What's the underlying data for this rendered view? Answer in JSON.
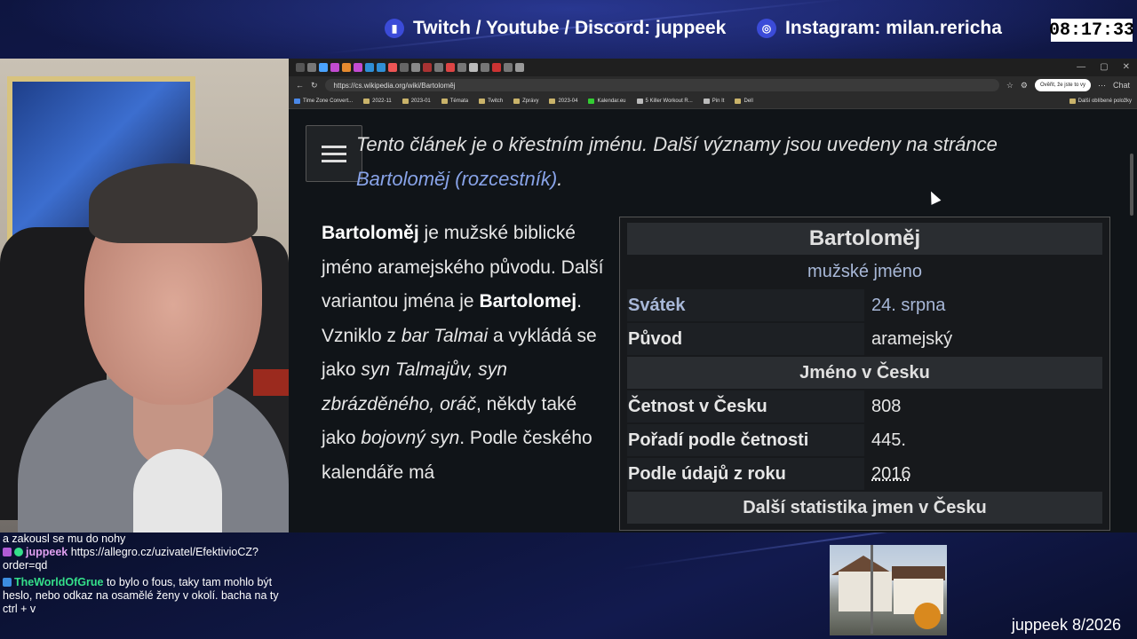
{
  "overlay": {
    "social_1": "Twitch / Youtube / Discord: juppeek",
    "social_2": "Instagram: milan.rericha",
    "clock": "08:17:33",
    "footer_label": "juppeek 8/2026"
  },
  "browser": {
    "url": "https://cs.wikipedia.org/wiki/Bartoloměj",
    "verify_pill": "Ověřit, že jste to vy",
    "chat_button": "Chat",
    "bookmarks": [
      "Time Zone Convert...",
      "2022-11",
      "2023-01",
      "Témata",
      "Twitch",
      "Zprávy",
      "2023-04",
      "Kalendar.eu",
      "5 Killer Workout R...",
      "Pin It",
      "Dell"
    ],
    "other_bookmarks": "Další oblíbené položky"
  },
  "article": {
    "hatnote_prefix": "Tento článek je o křestním jménu. Další významy jsou uvedeny na stránce",
    "hatnote_link": "Bartoloměj (rozcestník)",
    "hatnote_suffix": ".",
    "p_name": "Bartoloměj",
    "p_1": " je mužské biblické jméno aramejského původu. Další variantou jména je ",
    "p_variant": "Bartolomej",
    "p_2": ". Vzniklo z ",
    "p_i1": "bar Talmai",
    "p_3": " a vykládá se jako ",
    "p_i2": "syn Talmajův, syn zbrázděného, oráč",
    "p_4": ", někdy také jako ",
    "p_i3": "bojovný syn",
    "p_5": ". Podle českého kalendáře má"
  },
  "infobox": {
    "title": "Bartoloměj",
    "subtitle": "mužské jméno",
    "rows_1": [
      {
        "key": "Svátek",
        "value": "24. srpna"
      },
      {
        "key": "Původ",
        "value": "aramejský"
      }
    ],
    "section_1": "Jméno v Česku",
    "rows_2": [
      {
        "key": "Četnost v Česku",
        "value": "808"
      },
      {
        "key": "Pořadí podle četnosti",
        "value": "445."
      },
      {
        "key": "Podle údajů z roku",
        "value": "2016"
      }
    ],
    "section_2": "Další statistika jmen v Česku"
  },
  "chat": {
    "line_0": "a zakousl se mu do nohy",
    "m1_user": "juppeek",
    "m1_text": "https://allegro.cz/uzivatel/EfektivioCZ?order=qd",
    "m2_user": "TheWorldOfGrue",
    "m2_text": "to bylo o fous, taky tam mohlo být heslo, nebo odkaz na osamělé ženy v okolí. bacha na ty ctrl + v"
  },
  "colors": {
    "link": "#88a3e8",
    "chat_user_1": "#e0a0f0",
    "chat_user_2": "#35e08a"
  }
}
